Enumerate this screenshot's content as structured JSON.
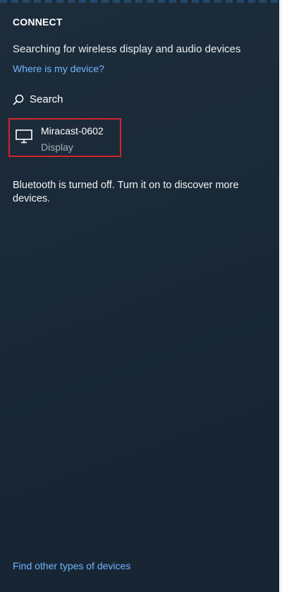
{
  "panel": {
    "title": "CONNECT",
    "status_text": "Searching for wireless display and audio devices",
    "where_link": "Where is my device?",
    "search": {
      "label": "Search",
      "icon": "search-icon"
    },
    "devices": [
      {
        "name": "Miracast-0602",
        "type": "Display",
        "icon": "monitor-icon"
      }
    ],
    "bluetooth_message": "Bluetooth is turned off. Turn it on to discover more devices.",
    "find_other_link": "Find other types of devices",
    "colors": {
      "background": "#1b2a38",
      "link": "#6fb6ff",
      "highlight_border": "#d2232a",
      "secondary_text": "#a7b0b8"
    }
  }
}
